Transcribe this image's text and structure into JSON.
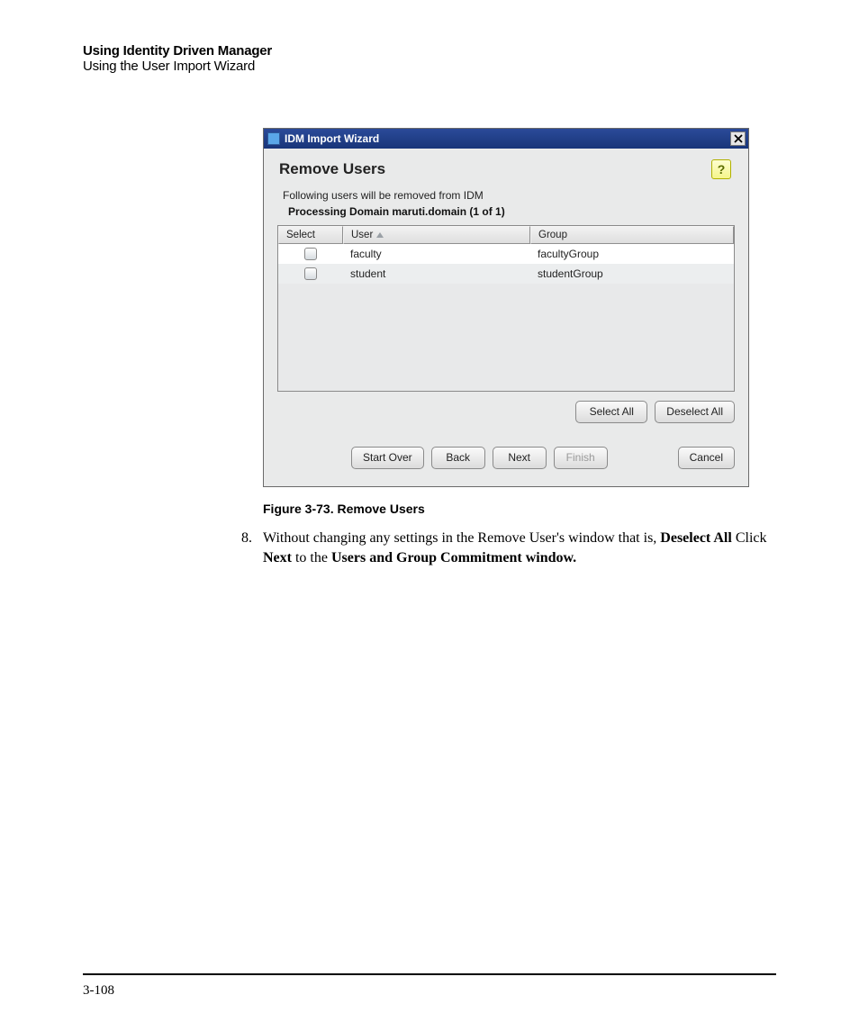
{
  "header": {
    "title": "Using Identity Driven Manager",
    "subtitle": "Using the User Import Wizard"
  },
  "dialog": {
    "window_title": "IDM Import Wizard",
    "heading": "Remove Users",
    "description": "Following users will be removed from IDM",
    "processing": "Processing Domain maruti.domain (1 of 1)",
    "columns": {
      "select": "Select",
      "user": "User",
      "group": "Group"
    },
    "rows": [
      {
        "user": "faculty",
        "group": "facultyGroup"
      },
      {
        "user": "student",
        "group": "studentGroup"
      }
    ],
    "buttons": {
      "select_all": "Select All",
      "deselect_all": "Deselect All",
      "start_over": "Start Over",
      "back": "Back",
      "next": "Next",
      "finish": "Finish",
      "cancel": "Cancel"
    }
  },
  "figure_caption": "Figure 3-73. Remove Users",
  "step": {
    "num": "8.",
    "t1": "Without changing any settings in the Remove User's window that is, ",
    "t2": "Deselect All",
    "t3": " Click ",
    "t4": "Next",
    "t5": " to the ",
    "t6": "Users and Group Commitment window."
  },
  "page_number": "3-108"
}
